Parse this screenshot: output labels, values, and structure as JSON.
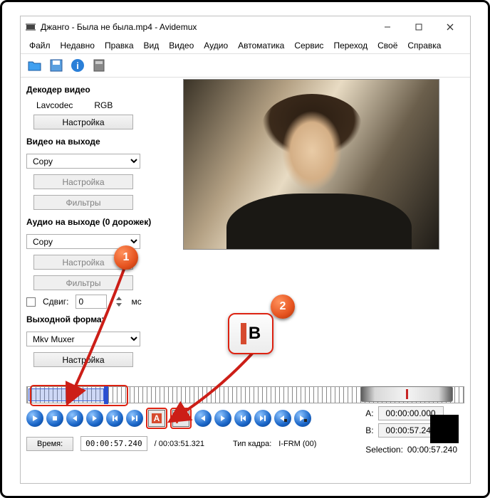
{
  "window": {
    "title": "Джанго - Была не была.mp4 - Avidemux"
  },
  "menu": [
    "Файл",
    "Недавно",
    "Правка",
    "Вид",
    "Видео",
    "Аудио",
    "Автоматика",
    "Сервис",
    "Переход",
    "Своё",
    "Справка"
  ],
  "toolbar_icons": [
    "open",
    "save",
    "info",
    "media"
  ],
  "sections": {
    "decoder": {
      "title": "Декодер видео",
      "codec": "Lavcodec",
      "format": "RGB",
      "settings_btn": "Настройка"
    },
    "video_out": {
      "title": "Видео на выходе",
      "select_value": "Copy",
      "settings_btn": "Настройка",
      "filters_btn": "Фильтры"
    },
    "audio_out": {
      "title": "Aудио на выходе (0 дорожек)",
      "select_value": "Copy",
      "settings_btn": "Настройка",
      "filters_btn": "Фильтры",
      "shift_label": "Сдвиг:",
      "shift_value": "0",
      "shift_unit": "мс"
    },
    "format_out": {
      "title": "Выходной формат",
      "select_value": "Mkv Muxer",
      "settings_btn": "Настройка"
    }
  },
  "markers": {
    "a_label": "A:",
    "a_value": "00:00:00.000",
    "b_label": "B:",
    "b_value": "00:00:57.240",
    "selection_label": "Selection:",
    "selection_value": "00:00:57.240"
  },
  "info": {
    "time_btn": "Время:",
    "time_value": "00:00:57.240",
    "duration": "/ 00:03:51.321",
    "frame_type_label": "Тип кадра:",
    "frame_type_value": "I-FRM (00)"
  },
  "callouts": {
    "one": "1",
    "two": "2"
  }
}
